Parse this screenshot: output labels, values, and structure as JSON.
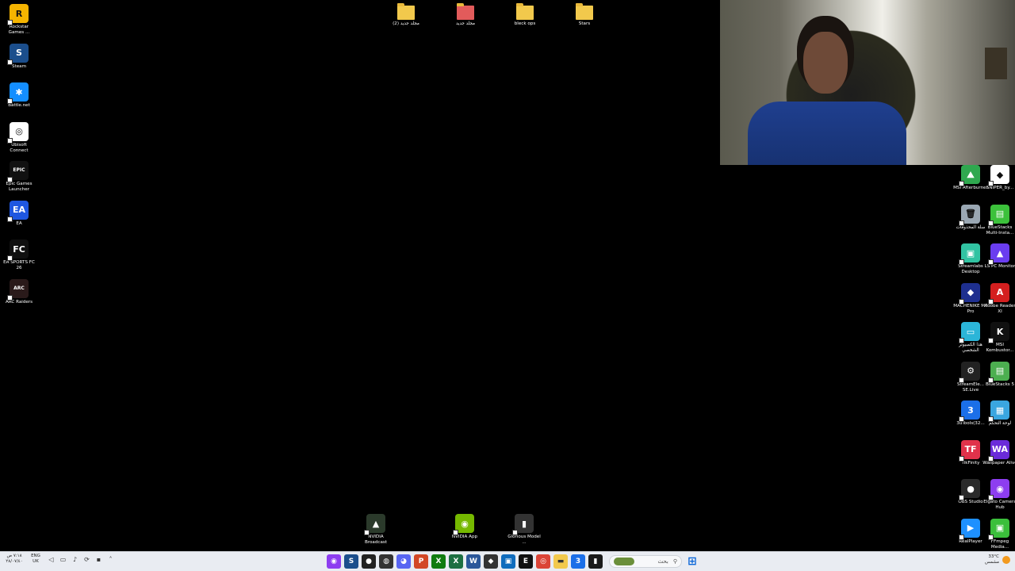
{
  "desktop": {
    "left_icons": [
      {
        "label": "Rockstar Games ...",
        "icon": "rockstar-icon",
        "glyph": "R",
        "color": "#f5b400"
      },
      {
        "label": "Steam",
        "icon": "steam-icon",
        "glyph": "S",
        "color": "#1b4e8c"
      },
      {
        "label": "Battle.net",
        "icon": "battlenet-icon",
        "glyph": "✱",
        "color": "#148eff"
      },
      {
        "label": "Ubisoft Connect",
        "icon": "ubisoft-icon",
        "glyph": "◎",
        "color": "#ffffff"
      },
      {
        "label": "Epic Games Launcher",
        "icon": "epic-games-icon",
        "glyph": "EPIC",
        "color": "#111111"
      },
      {
        "label": "EA",
        "icon": "ea-icon",
        "glyph": "EA",
        "color": "#1f57e0"
      },
      {
        "label": "EA SPORTS FC 26",
        "icon": "ea-sports-fc-icon",
        "glyph": "FC",
        "color": "#101010"
      },
      {
        "label": "ARC Raiders",
        "icon": "arc-raiders-icon",
        "glyph": "ARC",
        "color": "#2a1a1a"
      }
    ],
    "top_folders": [
      {
        "label": "مجلد جديد (2)",
        "icon": "folder-icon",
        "color": "#f2c94c"
      },
      {
        "label": "مجلد جديد",
        "icon": "folder-image-icon",
        "color": "#e25b5b"
      },
      {
        "label": "bleck ops",
        "icon": "folder-icon",
        "color": "#f2c94c"
      },
      {
        "label": "Stars",
        "icon": "folder-icon",
        "color": "#f2c94c"
      }
    ],
    "right_icons": [
      {
        "label": "MSI Afterburner",
        "icon": "msi-afterburner-icon",
        "glyph": "⛰",
        "color": "#2fa84f"
      },
      {
        "label": "SNIPER_by...",
        "icon": "sniper-icon",
        "glyph": "◆",
        "color": "#ffffff"
      },
      {
        "label": "سلة المحذوفات",
        "icon": "recycle-bin-icon",
        "glyph": "🗑",
        "color": "#9aa7b3"
      },
      {
        "label": "BlueStacks Multi-Insta...",
        "icon": "bluestacks-multi-icon",
        "glyph": "▤",
        "color": "#3cc13b"
      },
      {
        "label": "Streamlabs Desktop",
        "icon": "streamlabs-icon",
        "glyph": "▣",
        "color": "#31c3a2"
      },
      {
        "label": "LS PC Monitor",
        "icon": "ls-pc-monitor-icon",
        "glyph": "▲",
        "color": "#6a3df0"
      },
      {
        "label": "MACHENIKE M7 Pro",
        "icon": "machenike-icon",
        "glyph": "◆",
        "color": "#1e2f8f"
      },
      {
        "label": "Adobe Reader XI",
        "icon": "adobe-reader-icon",
        "glyph": "A",
        "color": "#d41f1f"
      },
      {
        "label": "هذا الكمبيوتر الشخصي",
        "icon": "this-pc-icon",
        "glyph": "▭",
        "color": "#2bb5d8"
      },
      {
        "label": "MSI Kombustor...",
        "icon": "msi-kombustor-icon",
        "glyph": "K",
        "color": "#111111"
      },
      {
        "label": "StreamEle... SE.Live",
        "icon": "streamelements-icon",
        "glyph": "⚙",
        "color": "#222222"
      },
      {
        "label": "BlueStacks 5",
        "icon": "bluestacks-icon",
        "glyph": "▤",
        "color": "#4caf50"
      },
      {
        "label": "3uTools(32...",
        "icon": "3utools-icon",
        "glyph": "3",
        "color": "#1b6fe8"
      },
      {
        "label": "لوحة التحكم",
        "icon": "control-panel-icon",
        "glyph": "▦",
        "color": "#3aa6e0"
      },
      {
        "label": "TikFinity",
        "icon": "tikfinity-icon",
        "glyph": "TF",
        "color": "#e0324b"
      },
      {
        "label": "Wallpaper Alive",
        "icon": "wallpaper-alive-icon",
        "glyph": "WA",
        "color": "#6a2bd9"
      },
      {
        "label": "OBS Studio",
        "icon": "obs-icon",
        "glyph": "●",
        "color": "#2a2a2a"
      },
      {
        "label": "Elgato Camera Hub",
        "icon": "elgato-icon",
        "glyph": "◉",
        "color": "#8d3df0"
      },
      {
        "label": "RealPlayer",
        "icon": "realplayer-icon",
        "glyph": "▶",
        "color": "#1e90ff"
      },
      {
        "label": "FFmpeg Media...",
        "icon": "ffmpeg-icon",
        "glyph": "▣",
        "color": "#3bbf3b"
      }
    ],
    "bottom_icons": [
      {
        "label": "NVIDIA Broadcast",
        "icon": "nvidia-broadcast-icon",
        "glyph": "▲",
        "color": "#2b3a2b"
      },
      {
        "label": "NVIDIA App",
        "icon": "nvidia-app-icon",
        "glyph": "◉",
        "color": "#76b900"
      },
      {
        "label": "Glorious Model ...",
        "icon": "glorious-mouse-icon",
        "glyph": "▮",
        "color": "#333333"
      }
    ]
  },
  "taskbar": {
    "clock_time": "٧:١٨ ص",
    "clock_date": "٢٨/٠٧/٤٠",
    "lang_top": "ENG",
    "lang_bottom": "UK",
    "search_placeholder": "بحث",
    "weather_temp": "33°C",
    "weather_text": "مشمس",
    "apps": [
      {
        "icon": "camera-hub-taskbar-icon",
        "color": "#8d3df0",
        "glyph": "◉"
      },
      {
        "icon": "steam-taskbar-icon",
        "color": "#1b4e8c",
        "glyph": "S"
      },
      {
        "icon": "record-taskbar-icon",
        "color": "#222222",
        "glyph": "●"
      },
      {
        "icon": "obs-taskbar-icon",
        "color": "#333333",
        "glyph": "◍"
      },
      {
        "icon": "discord-taskbar-icon",
        "color": "#5865f2",
        "glyph": "◕"
      },
      {
        "icon": "powerpoint-taskbar-icon",
        "color": "#d24726",
        "glyph": "P"
      },
      {
        "icon": "xbox-taskbar-icon",
        "color": "#107c10",
        "glyph": "X"
      },
      {
        "icon": "excel-taskbar-icon",
        "color": "#1d6f42",
        "glyph": "X"
      },
      {
        "icon": "word-taskbar-icon",
        "color": "#2b579a",
        "glyph": "W"
      },
      {
        "icon": "cube-taskbar-icon",
        "color": "#333333",
        "glyph": "◆"
      },
      {
        "icon": "store-taskbar-icon",
        "color": "#0f6cbd",
        "glyph": "▣"
      },
      {
        "icon": "epic-taskbar-icon",
        "color": "#111111",
        "glyph": "E"
      },
      {
        "icon": "chrome-taskbar-icon",
        "color": "#db4437",
        "glyph": "◎"
      },
      {
        "icon": "file-explorer-taskbar-icon",
        "color": "#f2c94c",
        "glyph": "▬"
      },
      {
        "icon": "3utools-taskbar-icon",
        "color": "#1b6fe8",
        "glyph": "3"
      },
      {
        "icon": "terminal-taskbar-icon",
        "color": "#1a1a1a",
        "glyph": "▮"
      }
    ]
  }
}
